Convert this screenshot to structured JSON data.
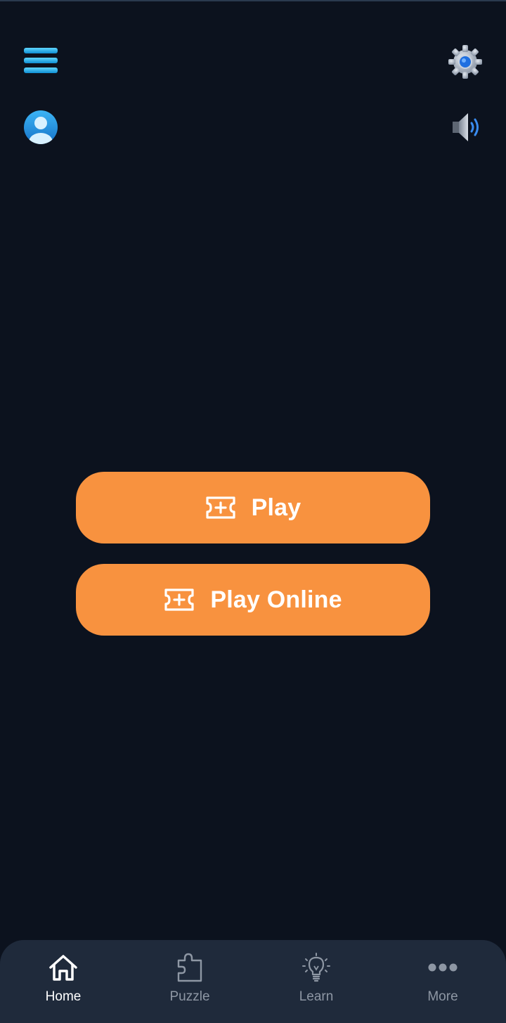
{
  "header": {
    "menu_icon": "hamburger-menu-icon",
    "profile_icon": "user-avatar-icon",
    "settings_icon": "gear-icon",
    "sound_icon": "speaker-icon",
    "accent_color": "#22b8f0"
  },
  "main": {
    "play_label": "Play",
    "play_online_label": "Play Online",
    "button_color": "#f8923f",
    "button_icon": "ticket-plus-icon"
  },
  "bottom_nav": {
    "items": [
      {
        "label": "Home",
        "icon": "home-icon",
        "active": true
      },
      {
        "label": "Puzzle",
        "icon": "puzzle-icon",
        "active": false
      },
      {
        "label": "Learn",
        "icon": "lightbulb-icon",
        "active": false
      },
      {
        "label": "More",
        "icon": "more-dots-icon",
        "active": false
      }
    ],
    "background": "#1f2a3b"
  },
  "colors": {
    "background": "#0c121e",
    "active_text": "#ffffff",
    "inactive_text": "#8e97a4"
  }
}
